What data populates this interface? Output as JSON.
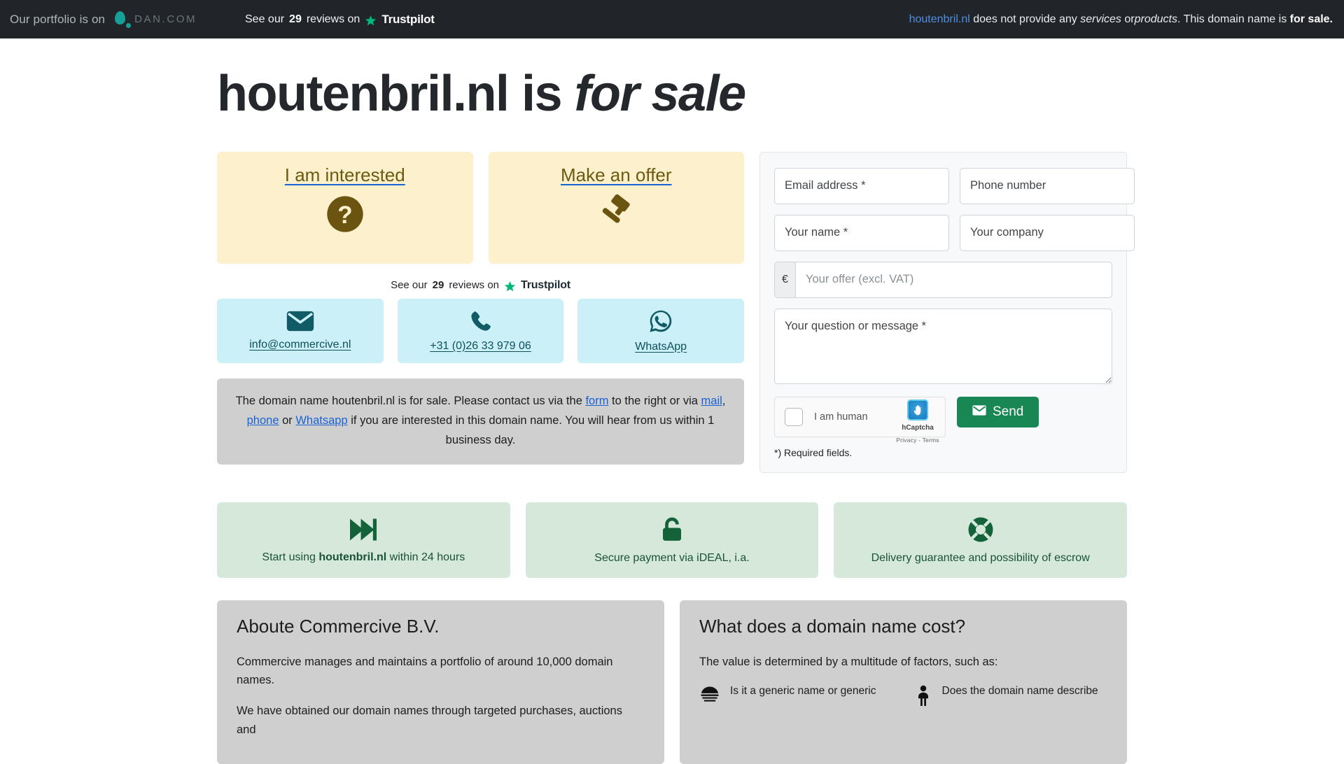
{
  "topbar": {
    "portfolio_text": "Our portfolio is on",
    "dan_word": "DAN.COM",
    "trust_prefix": "See our",
    "trust_count": "29",
    "trust_mid": "reviews on",
    "trust_brand": "Trustpilot",
    "notice_domain": "houtenbril.nl",
    "notice_part1": "does not provide any",
    "notice_em1": "services",
    "notice_or": "or",
    "notice_em2": "products",
    "notice_part2": ". This domain name is",
    "notice_bold": "for sale."
  },
  "hero": {
    "domain": "houtenbril.nl",
    "is": "is",
    "for_sale": "for sale"
  },
  "cta": [
    {
      "label": "I am interested",
      "icon": "question-mark-circle-icon"
    },
    {
      "label": "Make an offer",
      "icon": "gavel-icon"
    }
  ],
  "trustline": {
    "prefix": "See our",
    "count": "29",
    "mid": "reviews on",
    "brand": "Trustpilot"
  },
  "contacts": [
    {
      "label": "info@commercive.nl",
      "icon": "envelope-icon"
    },
    {
      "label": "+31 (0)26 33 979 06",
      "icon": "phone-icon"
    },
    {
      "label": "WhatsApp",
      "icon": "whatsapp-icon"
    }
  ],
  "infobox": {
    "t1": "The domain name houtenbril.nl is for sale. Please contact us via the ",
    "link_form": "form",
    "t2": " to the right or via ",
    "link_mail": "mail",
    "t3": ", ",
    "link_phone": "phone",
    "t4": " or ",
    "link_whatsapp": "Whatsapp",
    "t5": " if you are interested in this domain name. You will hear from us within 1 business day."
  },
  "form": {
    "email_placeholder": "Email address *",
    "phone_placeholder": "Phone number",
    "name_placeholder": "Your name *",
    "company_placeholder": "Your company",
    "currency_symbol": "€",
    "offer_placeholder": "Your offer (excl. VAT)",
    "message_placeholder": "Your question or message *",
    "captcha_label": "I am human",
    "captcha_brand": "hCaptcha",
    "captcha_links": "Privacy - Terms",
    "send_label": "Send",
    "required_note": "*) Required fields."
  },
  "features": [
    {
      "icon": "fast-forward-icon",
      "pre": "Start using ",
      "strong": "houtenbril.nl",
      "post": " within 24 hours"
    },
    {
      "icon": "lock-icon",
      "pre": "Secure payment via iDEAL, i.a.",
      "strong": "",
      "post": ""
    },
    {
      "icon": "lifebuoy-icon",
      "pre": "Delivery guarantee and possibility of escrow",
      "strong": "",
      "post": ""
    }
  ],
  "about": {
    "heading": "Aboute Commercive B.V.",
    "p1": "Commercive manages and maintains a portfolio of around 10,000 domain names.",
    "p2": "We have obtained our domain names through targeted purchases, auctions and"
  },
  "cost": {
    "heading": "What does a domain name cost?",
    "intro": "The value is determined by a multitude of factors, such as:",
    "items": [
      {
        "icon": "globe-icon",
        "text": "Is it a generic name or generic"
      },
      {
        "icon": "person-icon",
        "text": "Does the domain name describe"
      }
    ]
  },
  "colors": {
    "topbar_bg": "#212529",
    "cta_bg": "#fdf1cd",
    "contact_bg": "#ccf0f8",
    "feature_bg": "#d5e8da",
    "panel_bg": "#cfcfcf",
    "send_green": "#198754",
    "link_blue": "#1a63d6",
    "trust_green": "#00b67a"
  }
}
